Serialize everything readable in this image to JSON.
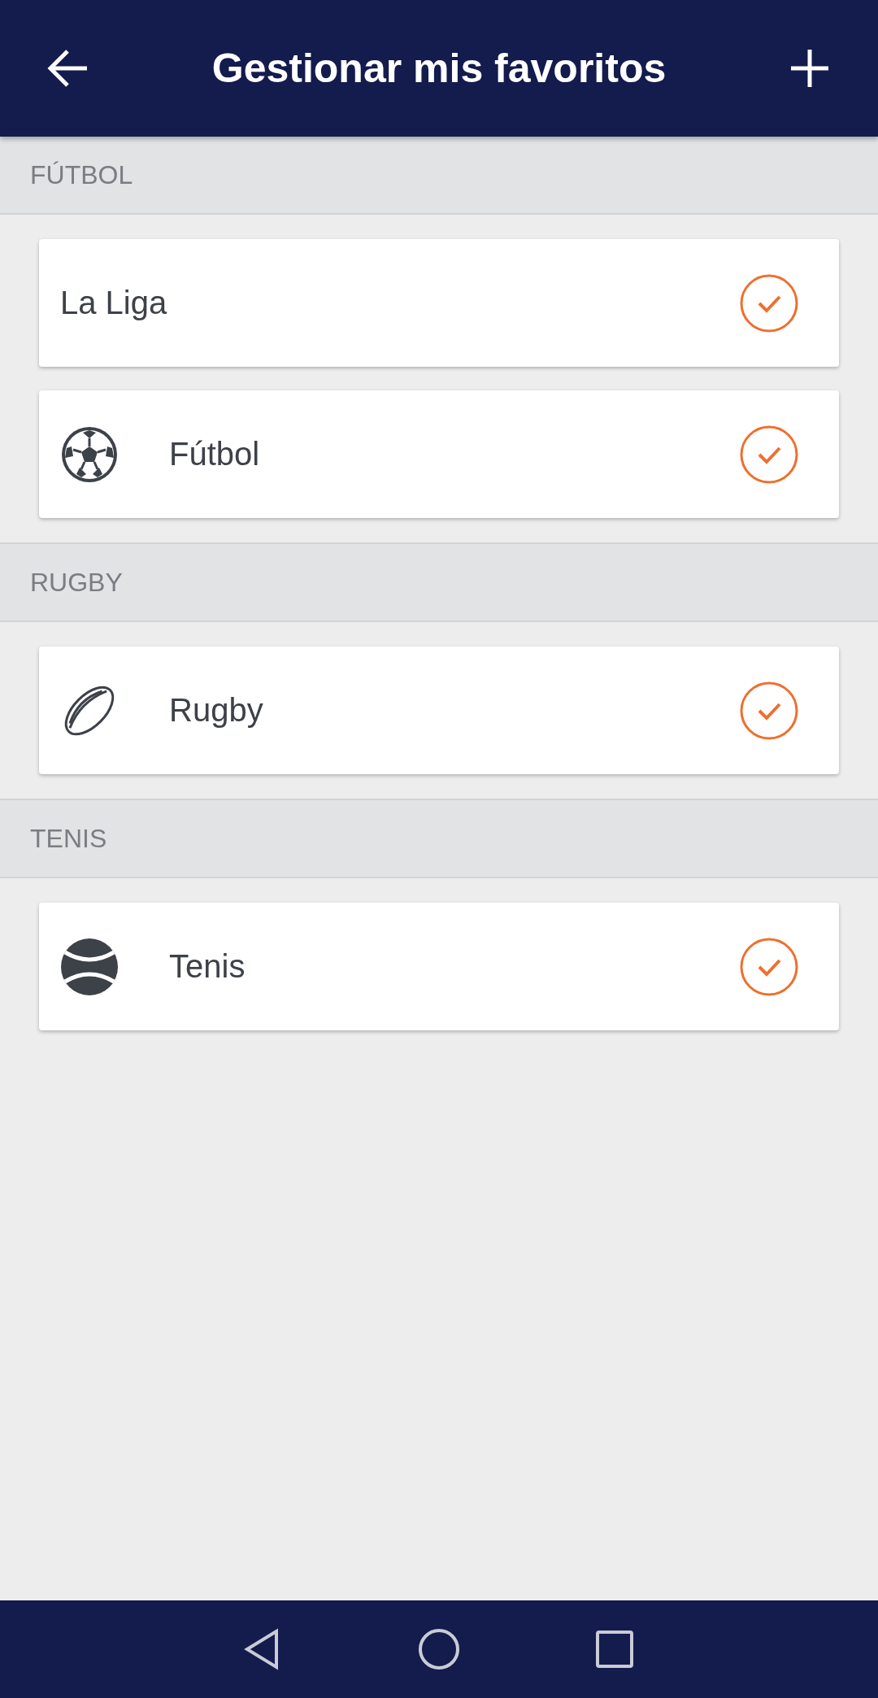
{
  "app_bar": {
    "title": "Gestionar mis favoritos"
  },
  "sections": [
    {
      "label": "FÚTBOL",
      "items": [
        {
          "label": "La Liga",
          "kind": "league",
          "checked": true
        },
        {
          "label": "Fútbol",
          "kind": "football",
          "checked": true
        }
      ]
    },
    {
      "label": "RUGBY",
      "items": [
        {
          "label": "Rugby",
          "kind": "rugby",
          "checked": true
        }
      ]
    },
    {
      "label": "TENIS",
      "items": [
        {
          "label": "Tenis",
          "kind": "tennis",
          "checked": true
        }
      ]
    }
  ]
}
